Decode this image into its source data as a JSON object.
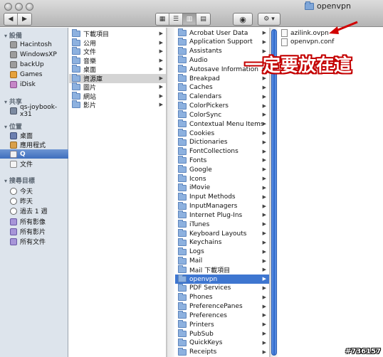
{
  "window": {
    "title": "openvpn"
  },
  "toolbar": {
    "back_icon": "chevron-left",
    "forward_icon": "chevron-right",
    "view_modes": [
      "icon-view",
      "list-view",
      "column-view",
      "coverflow-view"
    ],
    "active_view": "column-view",
    "quicklook_icon": "eye",
    "action_icon": "gear"
  },
  "sidebar": {
    "sections": [
      {
        "title": "設備",
        "items": [
          {
            "label": "Hacintosh",
            "icon": "hard-drive-icon"
          },
          {
            "label": "WindowsXP",
            "icon": "hard-drive-icon"
          },
          {
            "label": "backUp",
            "icon": "hard-drive-icon"
          },
          {
            "label": "Games",
            "icon": "drive-icon"
          },
          {
            "label": "iDisk",
            "icon": "idisk-icon"
          }
        ]
      },
      {
        "title": "共享",
        "items": [
          {
            "label": "qs-joybook-x31",
            "icon": "computer-icon"
          }
        ]
      },
      {
        "title": "位置",
        "items": [
          {
            "label": "桌面",
            "icon": "desktop-icon"
          },
          {
            "label": "應用程式",
            "icon": "applications-icon"
          },
          {
            "label": "Q",
            "icon": "home-icon",
            "selected": true
          },
          {
            "label": "文件",
            "icon": "documents-icon"
          }
        ]
      },
      {
        "title": "搜尋目標",
        "items": [
          {
            "label": "今天",
            "icon": "clock-icon"
          },
          {
            "label": "昨天",
            "icon": "clock-icon"
          },
          {
            "label": "過去 1 週",
            "icon": "clock-icon"
          },
          {
            "label": "所有影像",
            "icon": "smart-folder-icon"
          },
          {
            "label": "所有影片",
            "icon": "smart-folder-icon"
          },
          {
            "label": "所有文件",
            "icon": "smart-folder-icon"
          }
        ]
      }
    ]
  },
  "columns": {
    "home": {
      "items": [
        "下載項目",
        "公用",
        "文件",
        "音樂",
        "桌面",
        "資源庫",
        "圖片",
        "網站",
        "影片"
      ],
      "selected": "資源庫"
    },
    "library": {
      "items": [
        "Acrobat User Data",
        "Application Support",
        "Assistants",
        "Audio",
        "Autosave Information",
        "Breakpad",
        "Caches",
        "Calendars",
        "ColorPickers",
        "ColorSync",
        "Contextual Menu Items",
        "Cookies",
        "Dictionaries",
        "FontCollections",
        "Fonts",
        "Google",
        "Icons",
        "iMovie",
        "Input Methods",
        "InputManagers",
        "Internet Plug-Ins",
        "iTunes",
        "Keyboard Layouts",
        "Keychains",
        "Logs",
        "Mail",
        "Mail 下載項目",
        "openvpn",
        "PDF Services",
        "Phones",
        "PreferencePanes",
        "Preferences",
        "Printers",
        "PubSub",
        "QuickKeys",
        "Receipts"
      ],
      "selected": "openvpn"
    },
    "openvpn": {
      "items": [
        "azilink.ovpn",
        "openvpn.conf"
      ]
    }
  },
  "annotation": {
    "text": "一定要放在這",
    "color": "#c40000"
  },
  "watermark": "#736157"
}
